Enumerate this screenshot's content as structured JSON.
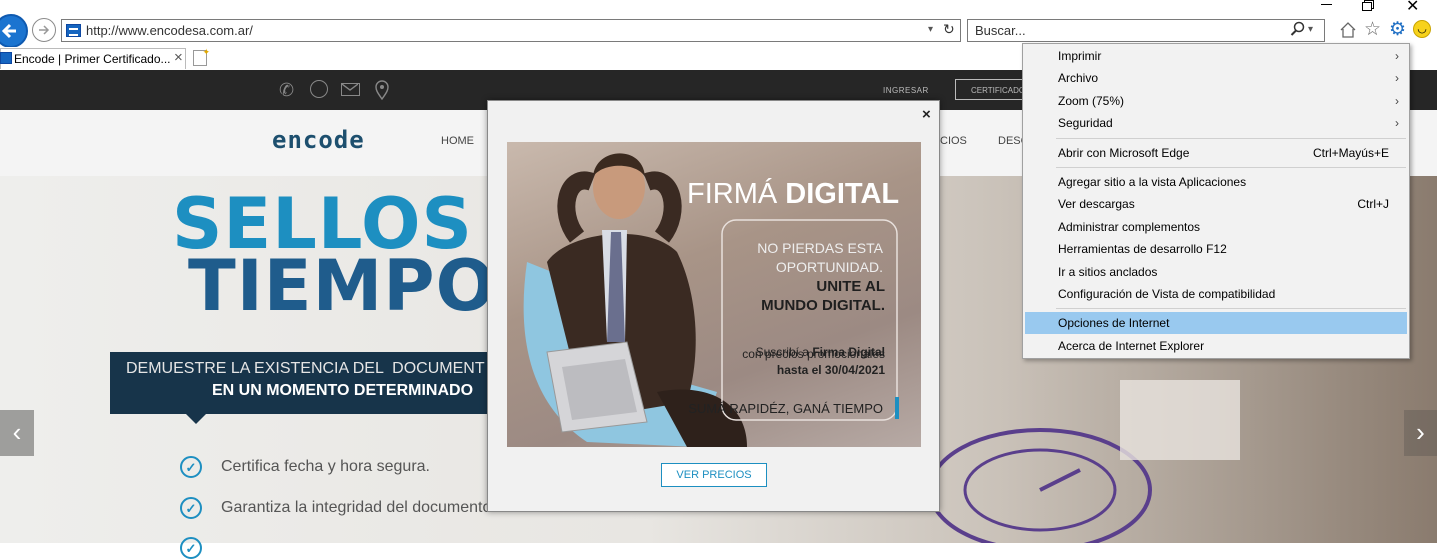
{
  "browser": {
    "address": "http://www.encodesa.com.ar/",
    "search_placeholder": "Buscar...",
    "tab_title": "Encode | Primer Certificado...",
    "tab_close": "×"
  },
  "site": {
    "topbar": {
      "ingresar": "INGRESAR",
      "certificado": "CERTIFICADO"
    },
    "logo": "encode",
    "nav": {
      "home": "HOME",
      "partial1": "CIOS",
      "partial2": "DESC"
    },
    "hero": {
      "title1": "SELLOS DI",
      "title2": "TIEMPO",
      "banner_line1": "DEMUESTRE LA EXISTENCIA DEL  DOCUMENT",
      "banner_line2": "EN UN MOMENTO DETERMINADO",
      "features": [
        "Certifica fecha y hora segura.",
        "Garantiza la integridad del documento."
      ]
    }
  },
  "modal": {
    "close": "×",
    "promo": {
      "headline_light": "FIRMÁ",
      "headline_bold": "DIGITAL",
      "line1": "NO PIERDAS ESTA",
      "line2": "OPORTUNIDAD.",
      "line3": "UNITE AL",
      "line4": "MUNDO DIGITAL.",
      "body1_pre": "Suscribí a ",
      "body1_bold": "Firma Digital",
      "body2": "con precios promocionales",
      "body3": "hasta el 30/04/2021",
      "tagline": "SUMÁ RAPIDÉZ, GANÁ TIEMPO"
    },
    "button": "VER PRECIOS"
  },
  "menu": {
    "items": [
      {
        "label": "Imprimir",
        "shortcut": "",
        "submenu": true
      },
      {
        "label": "Archivo",
        "shortcut": "",
        "submenu": true
      },
      {
        "label": "Zoom (75%)",
        "shortcut": "",
        "submenu": true
      },
      {
        "label": "Seguridad",
        "shortcut": "",
        "submenu": true
      },
      {
        "label": "Abrir con Microsoft Edge",
        "shortcut": "Ctrl+Mayús+E",
        "submenu": false
      },
      {
        "label": "Agregar sitio a la vista Aplicaciones",
        "shortcut": "",
        "submenu": false
      },
      {
        "label": "Ver descargas",
        "shortcut": "Ctrl+J",
        "submenu": false
      },
      {
        "label": "Administrar complementos",
        "shortcut": "",
        "submenu": false
      },
      {
        "label": "Herramientas de desarrollo F12",
        "shortcut": "",
        "submenu": false
      },
      {
        "label": "Ir a sitios anclados",
        "shortcut": "",
        "submenu": false
      },
      {
        "label": "Configuración de Vista de compatibilidad",
        "shortcut": "",
        "submenu": false
      },
      {
        "label": "Opciones de Internet",
        "shortcut": "",
        "submenu": false
      },
      {
        "label": "Acerca de Internet Explorer",
        "shortcut": "",
        "submenu": false
      }
    ],
    "submenu_arrow": "›",
    "highlighted_index": 11
  },
  "colors": {
    "accent": "#1d8fc1",
    "menu_highlight": "#99c9ef",
    "site_dark": "#262626"
  }
}
